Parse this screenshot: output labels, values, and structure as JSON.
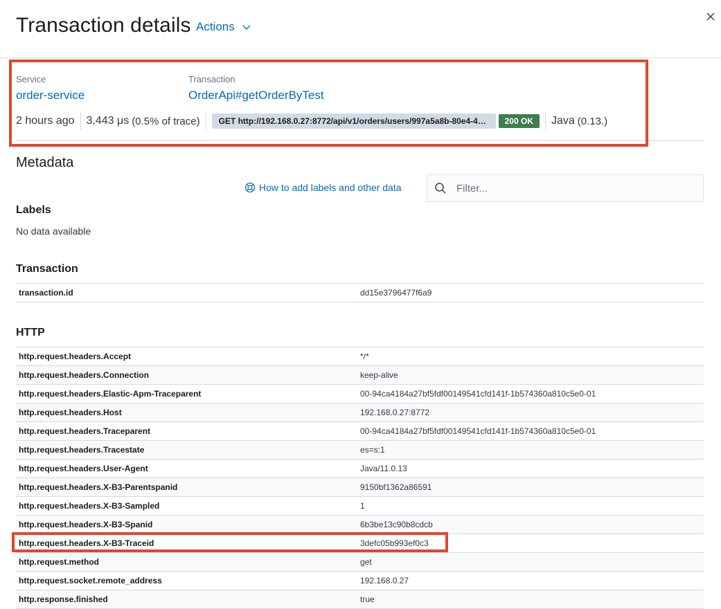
{
  "header": {
    "title": "Transaction details",
    "actions_label": "Actions"
  },
  "summary": {
    "service_label": "Service",
    "service_value": "order-service",
    "transaction_label": "Transaction",
    "transaction_value": "OrderApi#getOrderByTest",
    "time_ago": "2 hours ago",
    "duration": "3,443 μs",
    "trace_pct": "(0.5% of trace)",
    "url": "GET http://192.168.0.27:8772/api/v1/orders/users/997a5a8b-80e4-4a...",
    "status": "200 OK",
    "agent": "Java",
    "agent_version": "(0.13.)",
    "status_color": "#3f7d4c"
  },
  "metadata": {
    "heading": "Metadata",
    "help_link": "How to add labels and other data",
    "filter_placeholder": "Filter...",
    "labels_heading": "Labels",
    "labels_empty": "No data available",
    "transaction_heading": "Transaction",
    "transaction_rows": [
      {
        "key": "transaction.id",
        "value": "dd15e3796477f6a9"
      }
    ],
    "http_heading": "HTTP",
    "http_rows": [
      {
        "key": "http.request.headers.Accept",
        "value": "*/*"
      },
      {
        "key": "http.request.headers.Connection",
        "value": "keep-alive"
      },
      {
        "key": "http.request.headers.Elastic-Apm-Traceparent",
        "value": "00-94ca4184a27bf5fdf00149541cfd141f-1b574360a810c5e0-01"
      },
      {
        "key": "http.request.headers.Host",
        "value": "192.168.0.27:8772"
      },
      {
        "key": "http.request.headers.Traceparent",
        "value": "00-94ca4184a27bf5fdf00149541cfd141f-1b574360a810c5e0-01"
      },
      {
        "key": "http.request.headers.Tracestate",
        "value": "es=s:1"
      },
      {
        "key": "http.request.headers.User-Agent",
        "value": "Java/11.0.13"
      },
      {
        "key": "http.request.headers.X-B3-Parentspanid",
        "value": "9150bf1362a86591"
      },
      {
        "key": "http.request.headers.X-B3-Sampled",
        "value": "1"
      },
      {
        "key": "http.request.headers.X-B3-Spanid",
        "value": "6b3be13c90b8cdcb"
      },
      {
        "key": "http.request.headers.X-B3-Traceid",
        "value": "3defc05b993ef0c3"
      },
      {
        "key": "http.request.method",
        "value": "get"
      },
      {
        "key": "http.request.socket.remote_address",
        "value": "192.168.0.27"
      },
      {
        "key": "http.response.finished",
        "value": "true"
      }
    ]
  },
  "colors": {
    "link": "#006bb8",
    "highlight": "#e1482b"
  }
}
